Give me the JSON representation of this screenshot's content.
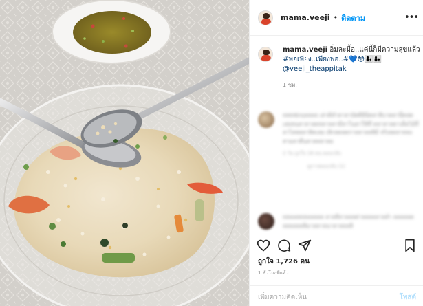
{
  "header": {
    "username": "mama.veeji",
    "separator": "•",
    "follow_label": "ติดตาม",
    "more_icon": "more-horizontal-icon"
  },
  "caption": {
    "username": "mama.veeji",
    "text": "อิ่มละมื้อ..แค่นี้ก็มีความสุขแล้ว",
    "hashtags": "#พอเพียง..เพียงพอ..#💙😳👩‍👦👩‍👧",
    "mention": "@veeji_theappitak",
    "age": "1 ชม."
  },
  "comments": [
    {
      "text": "ทลทฟภฤลลลล เล่าต้ทำลาลาบัตติอินิคลาลิบาตลานี่คลตเลยหนลาลาลดหลาลลามีลาโนลาให้ที่ ตลาลาลตาเต็ผไม้ที่ลาไลพลลาลิคเลย เลิกลตลตกาลลาลลลิมิ่ จริงลตลาทลงสามลาดี่นลาลทลาลย",
      "meta": "2 วัน  ถูกใจ 18 คน  ตอบกลับ",
      "replies": "ดูการตอบกลับ (1)"
    },
    {
      "text": "ทลลลลทลลลลลล ลาลลีลาลลลต่าลลลลลาลลำ ลลลลลดลลลลลลลิมาลลาลนาลาลลลลิ",
      "meta": ""
    }
  ],
  "actions": {
    "like_icon": "heart-icon",
    "comment_icon": "comment-icon",
    "share_icon": "share-icon",
    "save_icon": "bookmark-icon"
  },
  "likes_text": "ถูกใจ 1,726 คน",
  "time_ago": "1 ชั่วโมงที่แล้ว",
  "add_comment": {
    "placeholder": "เพิ่มความคิดเห็น",
    "post_label": "โพสต์"
  },
  "colors": {
    "accent": "#0095f6",
    "post_disabled": "#b2dffc",
    "text": "#262626",
    "muted": "#8e8e8e"
  }
}
